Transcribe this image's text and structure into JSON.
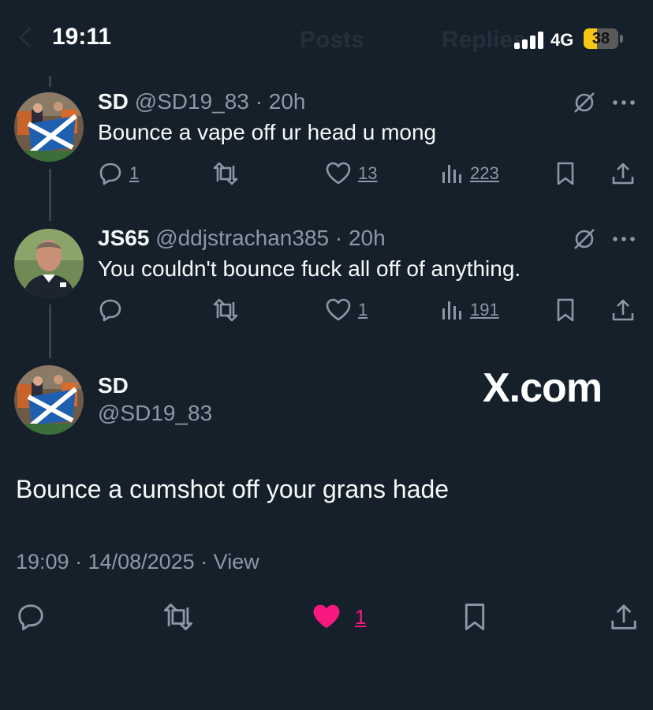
{
  "status_bar": {
    "time": "19:11",
    "network": "4G",
    "battery_level": "38",
    "battery_fraction": 0.38
  },
  "background_nav": {
    "tabs": [
      "Posts",
      "Replies"
    ]
  },
  "thread": [
    {
      "name": "SD",
      "handle": "@SD19_83",
      "separator": "·",
      "age": "20h",
      "text": "Bounce a vape off ur head u mong",
      "replies": "1",
      "likes": "13",
      "views": "223"
    },
    {
      "name": "JS65",
      "handle": "@ddjstrachan385",
      "separator": "·",
      "age": "20h",
      "text": "You couldn't bounce fuck all off of anything.",
      "replies": "",
      "likes": "1",
      "views": "191"
    }
  ],
  "main_post": {
    "name": "SD",
    "handle": "@SD19_83",
    "text": "Bounce a cumshot off your grans hade",
    "timestamp": "19:09 · 14/08/2025 · View",
    "likes": "1",
    "liked": true
  },
  "watermark": "X.com",
  "colors": {
    "background": "#15202b",
    "text_primary": "#f7f9f9",
    "text_secondary": "#8b98a5",
    "like_active": "#f91880",
    "thread_line": "#38444d",
    "battery": "#f6c714"
  },
  "icons": [
    "comment-icon",
    "retweet-icon",
    "heart-icon",
    "views-icon",
    "bookmark-icon",
    "share-icon",
    "grok-icon",
    "more-icon"
  ]
}
